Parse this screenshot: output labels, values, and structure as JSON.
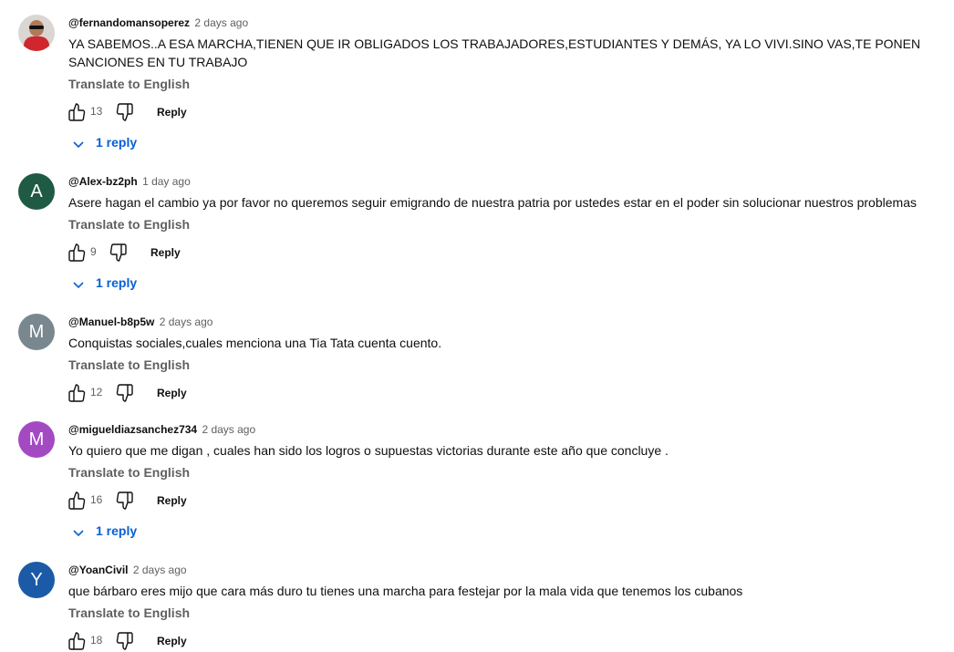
{
  "labels": {
    "translate": "Translate to English",
    "reply": "Reply"
  },
  "comments": [
    {
      "author": "@fernandomansoperez",
      "time": "2 days ago",
      "text": "YA SABEMOS..A ESA MARCHA,TIENEN QUE IR OBLIGADOS LOS TRABAJADORES,ESTUDIANTES Y DEMÁS, YA LO VIVI.SINO VAS,TE PONEN SANCIONES EN TU TRABAJO",
      "likes": "13",
      "replies": "1 reply",
      "avatar": {
        "type": "photo"
      }
    },
    {
      "author": "@Alex-bz2ph",
      "time": "1 day ago",
      "text": "Asere hagan el cambio ya por favor no queremos seguir emigrando de nuestra patria por ustedes estar en el poder sin solucionar nuestros problemas",
      "likes": "9",
      "replies": "1 reply",
      "avatar": {
        "letter": "A",
        "color": "#1e5a44"
      }
    },
    {
      "author": "@Manuel-b8p5w",
      "time": "2 days ago",
      "text": "Conquistas sociales,cuales menciona una Tia Tata cuenta cuento.",
      "likes": "12",
      "avatar": {
        "letter": "M",
        "color": "#79878e"
      }
    },
    {
      "author": "@migueldiazsanchez734",
      "time": "2 days ago",
      "text": "Yo quiero que me digan , cuales han sido los logros o supuestas victorias durante este año que concluye .",
      "likes": "16",
      "replies": "1 reply",
      "avatar": {
        "letter": "M",
        "color": "#a34ac3"
      }
    },
    {
      "author": "@YoanCivil",
      "time": "2 days ago",
      "text": "que bárbaro eres mijo que cara más duro tu tienes una marcha para festejar por la mala vida que tenemos los cubanos",
      "likes": "18",
      "avatar": {
        "letter": "Y",
        "color": "#1b5aa7"
      }
    }
  ],
  "colors": {
    "link_blue": "#065fd4",
    "muted": "#606060",
    "text": "#0f0f0f"
  },
  "icons": {
    "like": "thumb-up-icon",
    "dislike": "thumb-down-icon",
    "expand": "chevron-down-icon"
  }
}
